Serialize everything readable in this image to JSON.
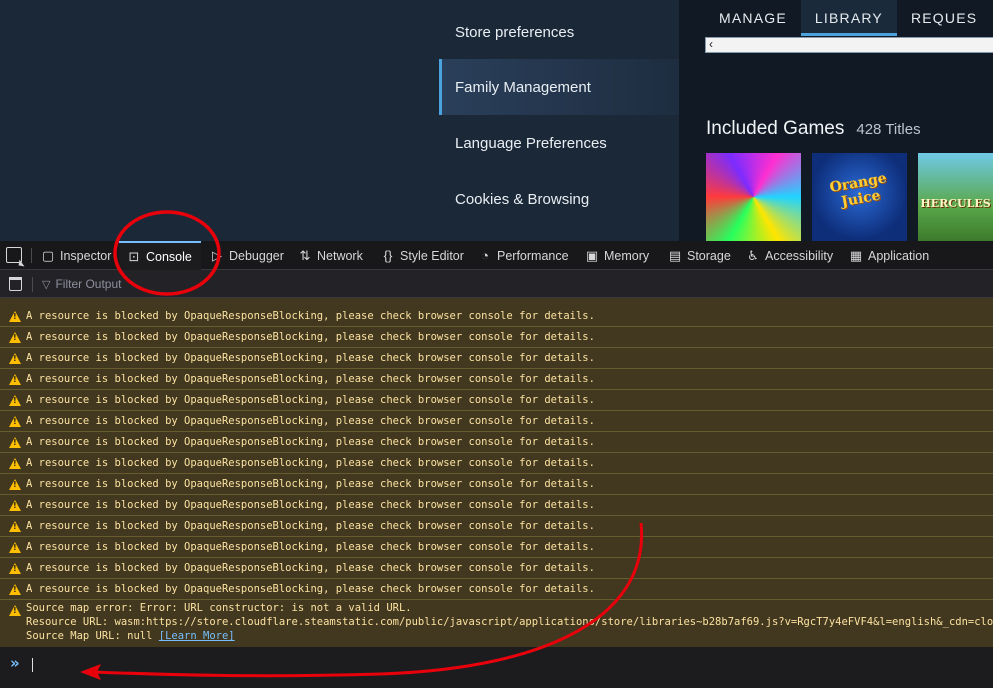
{
  "steam": {
    "pref_nav": [
      {
        "label": "Store preferences",
        "active": false
      },
      {
        "label": "Family Management",
        "active": true
      },
      {
        "label": "Language Preferences",
        "active": false
      },
      {
        "label": "Cookies & Browsing",
        "active": false
      }
    ],
    "tabs": [
      {
        "label": "MANAGE",
        "active": false
      },
      {
        "label": "LIBRARY",
        "active": true
      },
      {
        "label": "REQUES",
        "active": false
      }
    ],
    "included_title": "Included Games",
    "included_count": "428 Titles",
    "thumbs": [
      {
        "name": "colorful-game-thumbnail",
        "text": ""
      },
      {
        "name": "orange-juice-game-thumbnail",
        "text": "Orange Juice"
      },
      {
        "name": "hercules-game-thumbnail",
        "text": "HERCULES"
      }
    ]
  },
  "devtools": {
    "tools": [
      {
        "label": "Inspector",
        "icon": "inspector-icon"
      },
      {
        "label": "Console",
        "icon": "console-icon",
        "active": true
      },
      {
        "label": "Debugger",
        "icon": "debugger-icon"
      },
      {
        "label": "Network",
        "icon": "network-icon"
      },
      {
        "label": "Style Editor",
        "icon": "style-editor-icon"
      },
      {
        "label": "Performance",
        "icon": "performance-icon"
      },
      {
        "label": "Memory",
        "icon": "memory-icon"
      },
      {
        "label": "Storage",
        "icon": "storage-icon"
      },
      {
        "label": "Accessibility",
        "icon": "accessibility-icon"
      },
      {
        "label": "Application",
        "icon": "application-icon"
      }
    ],
    "filter_placeholder": "Filter Output",
    "warning_message": "A resource is blocked by OpaqueResponseBlocking, please check browser console for details.",
    "warning_count": 14,
    "source_map": {
      "line1": "Source map error: Error: URL constructor:  is not a valid URL.",
      "line2": "Resource URL: wasm:https://store.cloudflare.steamstatic.com/public/javascript/applications/store/libraries~b28b7af69.js?v=RgcT7y4eFVF4&l=english&_cdn=cloudflare%",
      "line3_prefix": "Source Map URL: null ",
      "learn_more": "[Learn More]"
    },
    "prompt": "»"
  },
  "colors": {
    "steam_bg": "#1b2838",
    "accent_blue": "#4aa3df",
    "warning_bg": "#42381f",
    "warning_text": "#fce2a1",
    "annotation_red": "#e8000b"
  }
}
